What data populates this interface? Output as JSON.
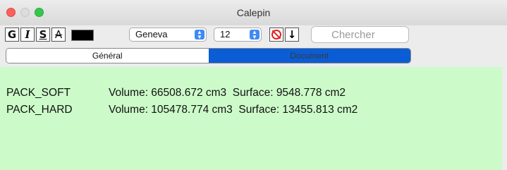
{
  "window": {
    "title": "Calepin"
  },
  "toolbar": {
    "bold_label": "G",
    "italic_label": "I",
    "shadow_label": "S",
    "strike_label": "A",
    "text_color": "#000000",
    "font_value": "Geneva",
    "size_value": "12",
    "arrow_label": "↓",
    "search_placeholder": "Chercher"
  },
  "tabs": [
    {
      "label": "Général",
      "selected": false
    },
    {
      "label": "Document",
      "selected": true
    }
  ],
  "content": {
    "background": "#ccfbc9",
    "rows": [
      {
        "name": "PACK_SOFT",
        "details": "Volume: 66508.672 cm3  Surface: 9548.778 cm2"
      },
      {
        "name": "PACK_HARD",
        "details": "Volume: 105478.774 cm3  Surface: 13455.813 cm2"
      }
    ]
  }
}
